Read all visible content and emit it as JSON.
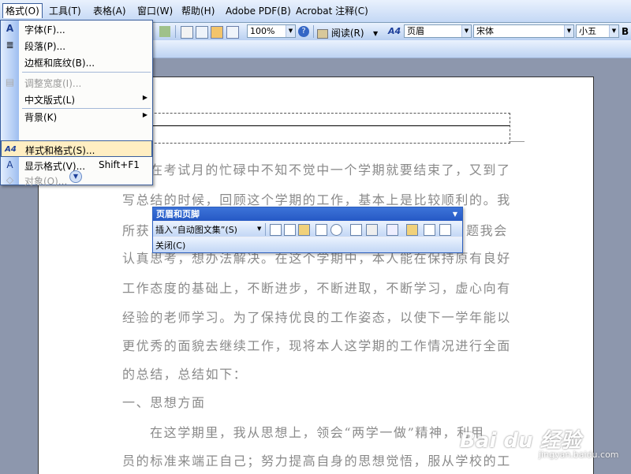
{
  "menubar": {
    "items": [
      {
        "label": "格式(O)",
        "active": true
      },
      {
        "label": "工具(T)"
      },
      {
        "label": "表格(A)"
      },
      {
        "label": "窗口(W)"
      },
      {
        "label": "帮助(H)"
      },
      {
        "label": "Adobe PDF(B)"
      },
      {
        "label": "Acrobat 注释(C)"
      }
    ]
  },
  "toolbar": {
    "zoom": "100%",
    "read_label": "阅读(R)",
    "style": "页眉",
    "font": "宋体",
    "size": "小五"
  },
  "format_menu": {
    "items": [
      {
        "label": "字体(F)...",
        "icon": "A"
      },
      {
        "label": "段落(P)...",
        "icon": "≣"
      },
      {
        "label": "边框和底纹(B)..."
      },
      {
        "label": "调整宽度(I)...",
        "disabled": true,
        "icon": "▤"
      },
      {
        "label": "中文版式(L)",
        "submenu": true
      },
      {
        "label": "背景(K)",
        "submenu": true
      },
      {
        "label": "样式和格式(S)...",
        "highlighted": true,
        "icon": "A4"
      },
      {
        "label": "显示格式(V)...",
        "shortcut": "Shift+F1",
        "icon": "A"
      },
      {
        "label": "对象(O)...",
        "disabled": true,
        "icon": "◇"
      }
    ],
    "expand_icon": "double-chevron-down-icon"
  },
  "document": {
    "paragraphs": [
      "在考试月的忙碌中不知不觉中一个学期就要结束了，又到了",
      "写总结的时候，回顾这个学期的工作，基本上是比较顺利的。我",
      "所获",
      "题我会",
      "认真思考，想办法解决。在这个学期中，本人能在保持原有良好",
      "工作态度的基础上，不断进步，不断进取，不断学习，虚心向有",
      "经验的老师学习。为了保持优良的工作姿态，以使下一学年能以",
      "更优秀的面貌去继续工作，现将本人这学期的工作情况进行全面",
      "的总结，总结如下：",
      "一、思想方面",
      "在这学期里，我从思想上，领会“两学一做”精神，利用",
      "员的标准来端正自己；努力提高自身的思想觉悟，服从学校的工"
    ]
  },
  "header_footer_toolbar": {
    "title": "页眉和页脚",
    "insert_autotext": "插入“自动图文集”(S)",
    "close_label": "关闭(C)"
  },
  "watermark": {
    "brand": "Bai du 经验",
    "url": "jingyan.baidu.com"
  }
}
